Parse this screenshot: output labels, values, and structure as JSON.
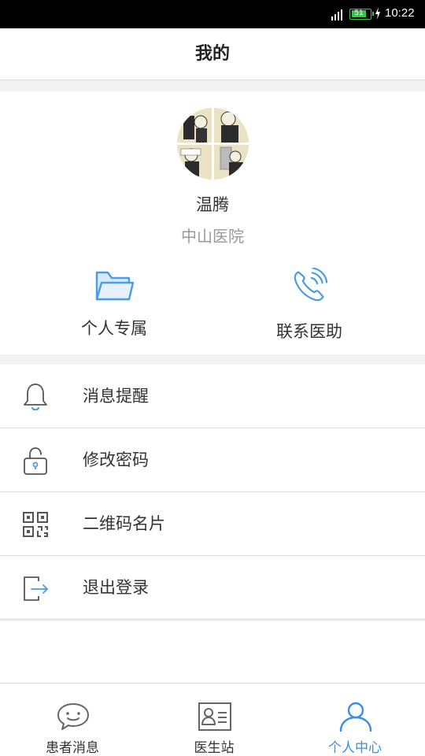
{
  "status_bar": {
    "time": "10:22",
    "battery_label": "51"
  },
  "header": {
    "title": "我的"
  },
  "profile": {
    "name": "温腾",
    "hospital": "中山医院"
  },
  "quick_actions": [
    {
      "label": "个人专属",
      "icon": "folder-icon"
    },
    {
      "label": "联系医助",
      "icon": "phone-icon"
    }
  ],
  "menu": [
    {
      "label": "消息提醒",
      "icon": "bell-icon"
    },
    {
      "label": "修改密码",
      "icon": "lock-icon"
    },
    {
      "label": "二维码名片",
      "icon": "qr-code-icon"
    },
    {
      "label": "退出登录",
      "icon": "logout-icon"
    }
  ],
  "tabs": [
    {
      "label": "患者消息",
      "icon": "chat-bubble-icon",
      "active": false
    },
    {
      "label": "医生站",
      "icon": "id-card-icon",
      "active": false
    },
    {
      "label": "个人中心",
      "icon": "user-icon",
      "active": true
    }
  ],
  "colors": {
    "accent": "#3a8ee6",
    "icon_blue": "#4a9be8",
    "icon_gray": "#666666",
    "divider": "#dcdcdc"
  }
}
